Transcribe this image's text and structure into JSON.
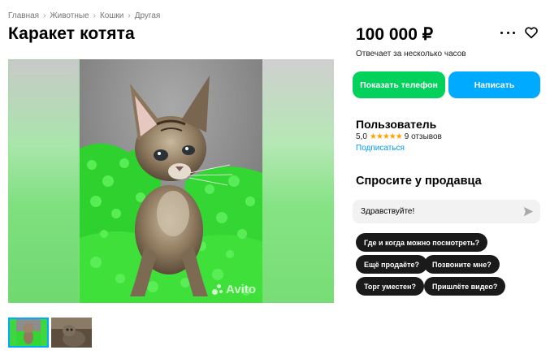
{
  "breadcrumb": [
    "Главная",
    "Животные",
    "Кошки",
    "Другая"
  ],
  "listing": {
    "title": "Каракет котята",
    "price": "100 000 ₽",
    "response_time": "Отвечает за несколько часов",
    "watermark": "Avito"
  },
  "actions": {
    "show_phone": "Показать телефон",
    "write": "Написать"
  },
  "seller": {
    "name": "Пользователь",
    "rating": "5,0",
    "stars": "★★★★★",
    "reviews": "9 отзывов",
    "subscribe": "Подписаться"
  },
  "ask": {
    "title": "Спросите у продавца",
    "message_value": "Здравствуйте!",
    "quick_questions": [
      "Где и когда можно посмотреть?",
      "Ещё продаёте?",
      "Позвоните мне?",
      "Торг уместен?",
      "Пришлёте видео?"
    ]
  },
  "colors": {
    "phone_button": "#02d15c",
    "write_button": "#00aaff",
    "star": "#ffa200",
    "link": "#0099f7"
  },
  "icons": [
    "more-icon",
    "heart-icon",
    "send-icon",
    "chevron-right-icon"
  ]
}
